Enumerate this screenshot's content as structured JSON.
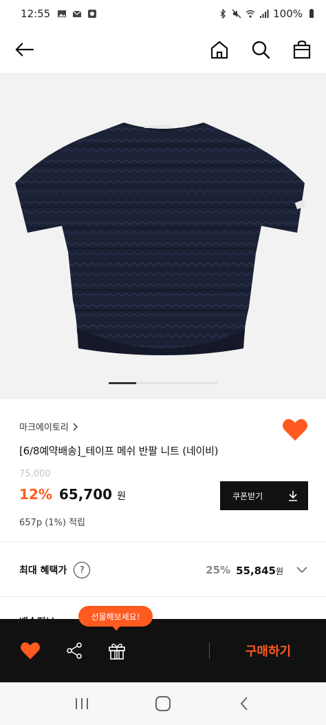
{
  "status_bar": {
    "time": "12:55",
    "battery": "100%",
    "icons": [
      "image-icon",
      "mail-icon",
      "app-icon",
      "bluetooth-icon",
      "mute-icon",
      "wifi-icon",
      "signal-icon",
      "battery-icon"
    ]
  },
  "top_nav": {
    "icons": [
      "back-arrow-icon",
      "home-icon",
      "search-icon",
      "shopping-bag-icon"
    ]
  },
  "carousel": {
    "current_page": 1
  },
  "product": {
    "brand": "마크에이토리",
    "title": "[6/8예약배송]_테이프 메쉬 반팔 니트 (네이비)",
    "original_price": "75,000",
    "discount": "12%",
    "sale_price": "65,700",
    "currency": "원",
    "points": "657p (1%) 적립",
    "wishlisted": true
  },
  "coupon": {
    "label": "쿠폰받기"
  },
  "max_benefit": {
    "label": "최대 혜택가",
    "help": "?",
    "percent": "25%",
    "price": "55,845",
    "currency": "원"
  },
  "next_section_title": "배송정보",
  "gift_tooltip": {
    "text": "선물해보세요!"
  },
  "bottom_bar": {
    "buy_label": "구매하기"
  },
  "colors": {
    "accent": "#ff5a1f",
    "dark": "#111111",
    "image_bg": "#f2f2f2",
    "garment": "#1c2235"
  }
}
